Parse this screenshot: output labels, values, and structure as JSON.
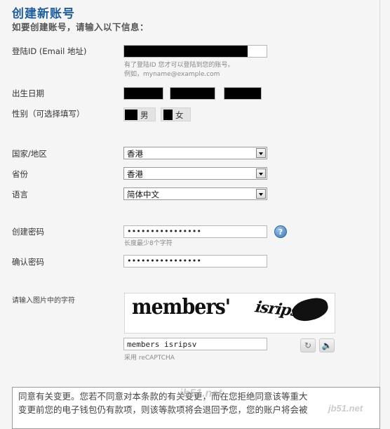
{
  "header": {
    "title": "创建新账号",
    "subtitle": "如要创建账号，请输入以下信息："
  },
  "fields": {
    "login_id": {
      "label": "登陆ID (Email 地址)",
      "hint_line1": "有了登陆ID 您才可以登陆到您的账号。",
      "hint_line2": "例如，myname@example.com"
    },
    "birthday": {
      "label": "出生日期"
    },
    "gender": {
      "label": "性别（可选择填写）",
      "options": [
        "男",
        "女"
      ]
    },
    "country": {
      "label": "国家/地区",
      "value": "香港"
    },
    "province": {
      "label": "省份",
      "value": "香港"
    },
    "language": {
      "label": "语言",
      "value": "简体中文"
    },
    "password": {
      "label": "创建密码",
      "value": "••••••••••••••••",
      "hint": "长度最少8个字符",
      "help": "?"
    },
    "confirm_password": {
      "label": "确认密码",
      "value": "••••••••••••••••"
    },
    "captcha": {
      "label": "请输入图片中的字符",
      "image_word1": "members'",
      "image_word2": "isripsv",
      "value": "members isripsv",
      "powered_by": "采用 reCAPTCHA"
    }
  },
  "icons": {
    "refresh": "refresh-icon",
    "audio": "speaker-icon",
    "help": "question-icon"
  },
  "terms": {
    "line1": "同意有关变更。您若不同意对本条款的有关变更，而在您拒绝同意该等重大",
    "line2": "变更前您的电子钱包仍有款项，则该等款项将会退回予您，您的账户将会被"
  },
  "watermarks": {
    "left": "jb51.net",
    "right": "jb51.net"
  },
  "colors": {
    "title": "#1f5e9e",
    "background": "#f5f5f5",
    "help_icon": "#3a78b5"
  }
}
